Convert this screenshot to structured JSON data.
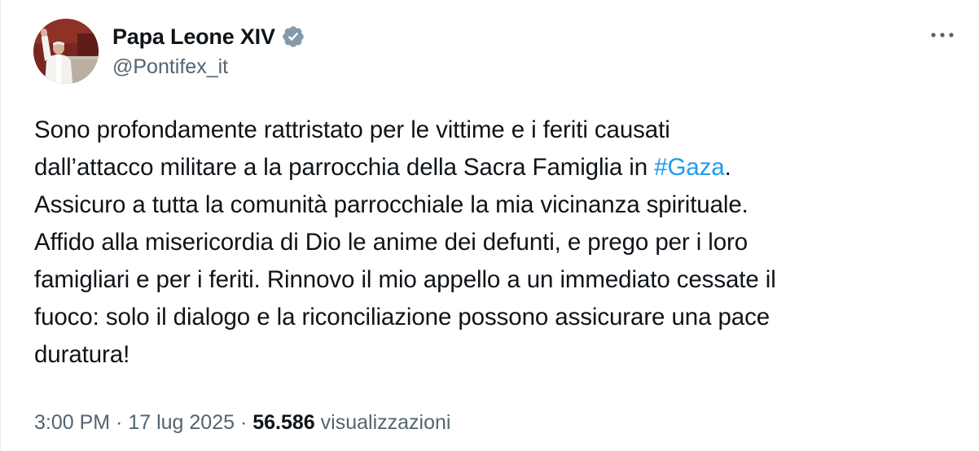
{
  "author": {
    "display_name": "Papa Leone XIV",
    "handle": "@Pontifex_it",
    "verified_icon": "verified-badge-icon",
    "verified_color": "#829aab"
  },
  "tweet": {
    "lines": [
      {
        "text": "Sono profondamente rattristato per le vittime e i feriti causati"
      },
      {
        "text": "dall’attacco militare a la parrocchia della Sacra Famiglia in ",
        "hashtag": "#Gaza",
        "after": "."
      },
      {
        "text": "Assicuro a tutta la comunità parrocchiale la mia vicinanza spirituale."
      },
      {
        "text": "Affido alla misericordia di Dio le anime dei defunti, e prego per i loro"
      },
      {
        "text": "famigliari e per i feriti. Rinnovo il mio appello a un immediato cessate il"
      },
      {
        "text": "fuoco: solo il dialogo e la riconciliazione possono assicurare una pace"
      },
      {
        "text": "duratura!"
      }
    ],
    "hashtag_color": "#1d9bf0"
  },
  "meta": {
    "time": "3:00 PM",
    "separator": " · ",
    "date": "17 lug 2025",
    "views_count": "56.586",
    "views_label": "visualizzazioni"
  },
  "menu": {
    "icon": "more-options-icon"
  }
}
